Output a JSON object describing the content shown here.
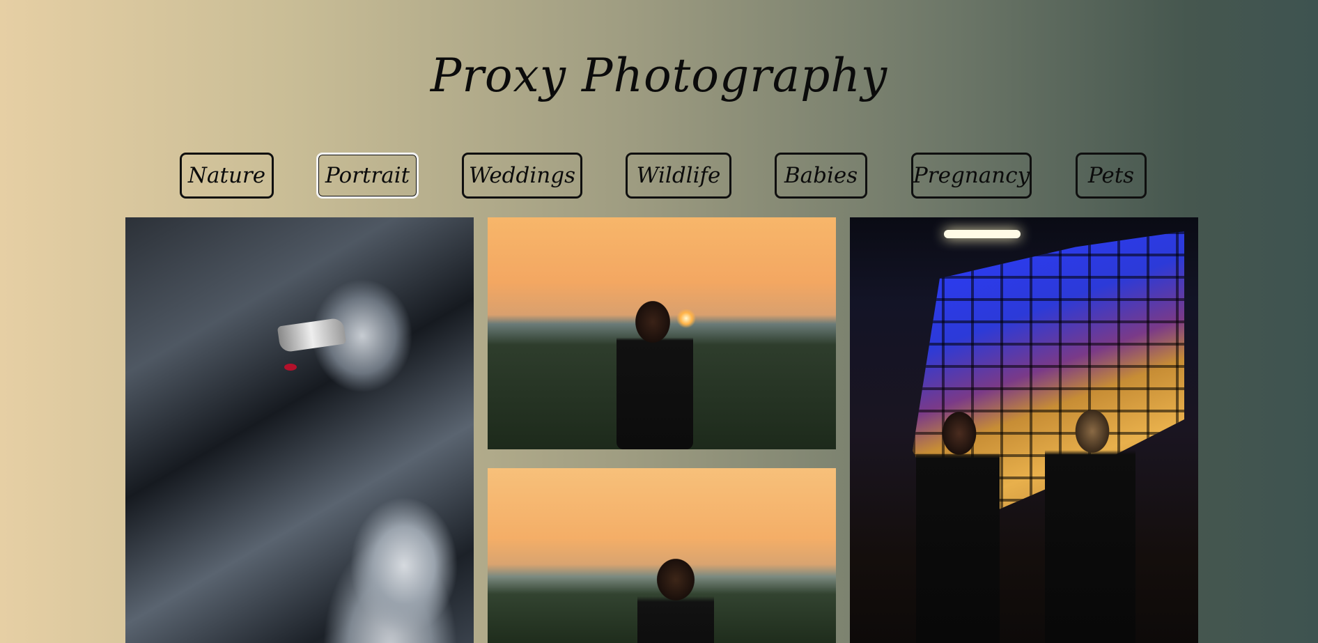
{
  "header": {
    "title": "Proxy Photography"
  },
  "nav": {
    "active": "Portrait",
    "items": [
      {
        "label": "Nature"
      },
      {
        "label": "Portrait"
      },
      {
        "label": "Weddings"
      },
      {
        "label": "Wildlife"
      },
      {
        "label": "Babies"
      },
      {
        "label": "Pregnancy"
      },
      {
        "label": "Pets"
      }
    ]
  },
  "gallery": {
    "photos": [
      {
        "subject": "woman in silver jacket with mirrored sunglasses"
      },
      {
        "subject": "woman in black at sunset in a field"
      },
      {
        "subject": "woman at sunset, close-up"
      },
      {
        "subject": "two women on a night street with illuminated building"
      }
    ]
  },
  "colors": {
    "background_left": "#e6cfa4",
    "background_right": "#3e5350",
    "button_border": "#0f0f0f",
    "active_button_border": "#f3f3f3"
  }
}
